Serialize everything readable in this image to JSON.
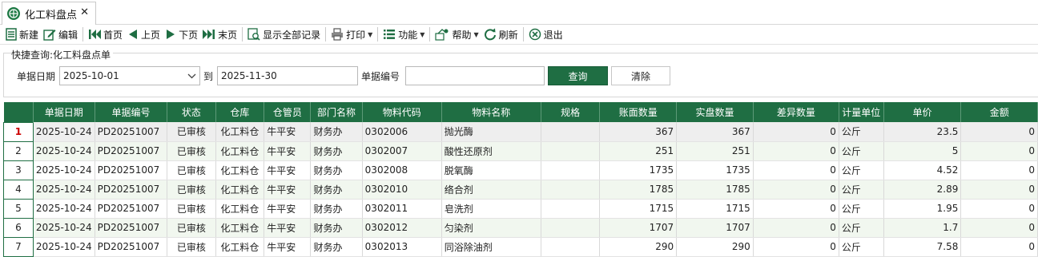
{
  "tab": {
    "title": "化工料盘点",
    "close": "✕"
  },
  "toolbar": {
    "new": "新建",
    "edit": "编辑",
    "first": "首页",
    "prev": "上页",
    "next": "下页",
    "last": "末页",
    "show_all": "显示全部记录",
    "print": "打印",
    "functions": "功能",
    "help": "帮助",
    "refresh": "刷新",
    "exit": "退出"
  },
  "quick_search": {
    "title": "快捷查询:化工料盘点单",
    "date_label": "单据日期",
    "date_from": "2025-10-01",
    "to_label": "到",
    "date_to": "2025-11-30",
    "doc_no_label": "单据编号",
    "doc_no_value": "",
    "query_button": "查询",
    "clear_button": "清除"
  },
  "grid": {
    "columns": [
      "单据日期",
      "单据编号",
      "状态",
      "仓库",
      "仓管员",
      "部门名称",
      "物料代码",
      "物料名称",
      "规格",
      "账面数量",
      "实盘数量",
      "差异数量",
      "计量单位",
      "单价",
      "金额"
    ],
    "rows": [
      [
        "1",
        "2025-10-24",
        "PD20251007",
        "已审核",
        "化工料仓",
        "牛平安",
        "财务办",
        "0302006",
        "抛光酶",
        "",
        "367",
        "367",
        "0",
        "公斤",
        "23.5",
        "0"
      ],
      [
        "2",
        "2025-10-24",
        "PD20251007",
        "已审核",
        "化工料仓",
        "牛平安",
        "财务办",
        "0302007",
        "酸性还原剂",
        "",
        "251",
        "251",
        "0",
        "公斤",
        "5",
        "0"
      ],
      [
        "3",
        "2025-10-24",
        "PD20251007",
        "已审核",
        "化工料仓",
        "牛平安",
        "财务办",
        "0302008",
        "脱氧酶",
        "",
        "1735",
        "1735",
        "0",
        "公斤",
        "4.52",
        "0"
      ],
      [
        "4",
        "2025-10-24",
        "PD20251007",
        "已审核",
        "化工料仓",
        "牛平安",
        "财务办",
        "0302010",
        "络合剂",
        "",
        "1785",
        "1785",
        "0",
        "公斤",
        "2.89",
        "0"
      ],
      [
        "5",
        "2025-10-24",
        "PD20251007",
        "已审核",
        "化工料仓",
        "牛平安",
        "财务办",
        "0302011",
        "皂洗剂",
        "",
        "1715",
        "1715",
        "0",
        "公斤",
        "1.95",
        "0"
      ],
      [
        "6",
        "2025-10-24",
        "PD20251007",
        "已审核",
        "化工料仓",
        "牛平安",
        "财务办",
        "0302012",
        "匀染剂",
        "",
        "1707",
        "1707",
        "0",
        "公斤",
        "1.7",
        "0"
      ],
      [
        "7",
        "2025-10-24",
        "PD20251007",
        "已审核",
        "化工料仓",
        "牛平安",
        "财务办",
        "0302013",
        "同浴除油剂",
        "",
        "290",
        "290",
        "0",
        "公斤",
        "7.58",
        "0"
      ]
    ]
  },
  "colors": {
    "header_green": "#1f6e43",
    "row_alt": "#f1f7ef",
    "selected_row_number": "#cc0000"
  }
}
